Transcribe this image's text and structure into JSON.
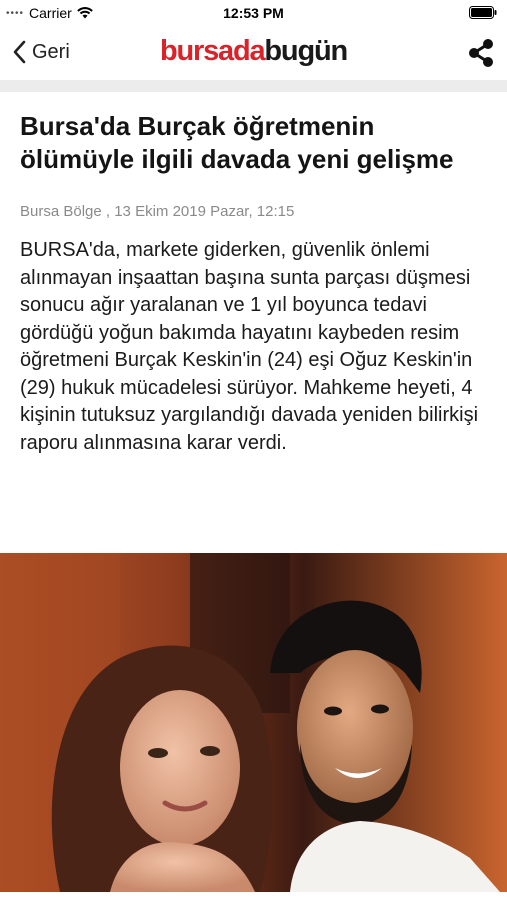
{
  "status_bar": {
    "carrier": "Carrier",
    "time": "12:53 PM"
  },
  "nav": {
    "back_label": "Geri",
    "logo_part1": "bursada",
    "logo_part2": "bugün",
    "icons": [
      "chevron-left-icon",
      "share-icon"
    ]
  },
  "article": {
    "headline": "Bursa'da Burçak öğretmenin ölümüyle ilgili davada yeni gelişme",
    "meta": "Bursa Bölge , 13 Ekim 2019 Pazar, 12:15",
    "body": "BURSA'da, markete giderken, güvenlik önlemi alınmayan inşaattan başına sunta parçası düşmesi sonucu ağır yaralanan ve 1 yıl boyunca tedavi gördüğü yoğun bakımda hayatını kaybeden resim öğretmeni Burçak Keskin'in (24) eşi Oğuz Keskin'in (29) hukuk mücadelesi sürüyor. Mahkeme heyeti, 4 kişinin tutuksuz yargılandığı davada yeniden bilirkişi raporu alınmasına karar verdi."
  },
  "colors": {
    "brand_red": "#d8232a",
    "divider": "#ececec",
    "meta_gray": "#8a8a8a"
  }
}
